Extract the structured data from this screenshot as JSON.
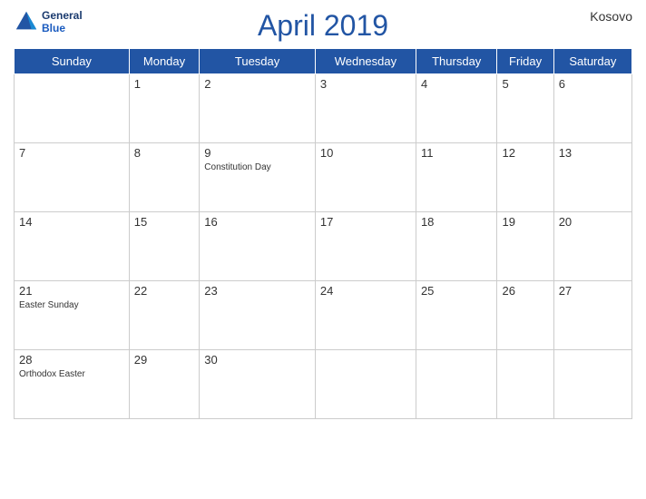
{
  "header": {
    "title": "April 2019",
    "region": "Kosovo",
    "logo_line1": "General",
    "logo_line2": "Blue"
  },
  "weekdays": [
    "Sunday",
    "Monday",
    "Tuesday",
    "Wednesday",
    "Thursday",
    "Friday",
    "Saturday"
  ],
  "weeks": [
    [
      {
        "day": "",
        "event": ""
      },
      {
        "day": "1",
        "event": ""
      },
      {
        "day": "2",
        "event": ""
      },
      {
        "day": "3",
        "event": ""
      },
      {
        "day": "4",
        "event": ""
      },
      {
        "day": "5",
        "event": ""
      },
      {
        "day": "6",
        "event": ""
      }
    ],
    [
      {
        "day": "7",
        "event": ""
      },
      {
        "day": "8",
        "event": ""
      },
      {
        "day": "9",
        "event": "Constitution Day"
      },
      {
        "day": "10",
        "event": ""
      },
      {
        "day": "11",
        "event": ""
      },
      {
        "day": "12",
        "event": ""
      },
      {
        "day": "13",
        "event": ""
      }
    ],
    [
      {
        "day": "14",
        "event": ""
      },
      {
        "day": "15",
        "event": ""
      },
      {
        "day": "16",
        "event": ""
      },
      {
        "day": "17",
        "event": ""
      },
      {
        "day": "18",
        "event": ""
      },
      {
        "day": "19",
        "event": ""
      },
      {
        "day": "20",
        "event": ""
      }
    ],
    [
      {
        "day": "21",
        "event": "Easter Sunday"
      },
      {
        "day": "22",
        "event": ""
      },
      {
        "day": "23",
        "event": ""
      },
      {
        "day": "24",
        "event": ""
      },
      {
        "day": "25",
        "event": ""
      },
      {
        "day": "26",
        "event": ""
      },
      {
        "day": "27",
        "event": ""
      }
    ],
    [
      {
        "day": "28",
        "event": "Orthodox Easter"
      },
      {
        "day": "29",
        "event": ""
      },
      {
        "day": "30",
        "event": ""
      },
      {
        "day": "",
        "event": ""
      },
      {
        "day": "",
        "event": ""
      },
      {
        "day": "",
        "event": ""
      },
      {
        "day": "",
        "event": ""
      }
    ]
  ]
}
